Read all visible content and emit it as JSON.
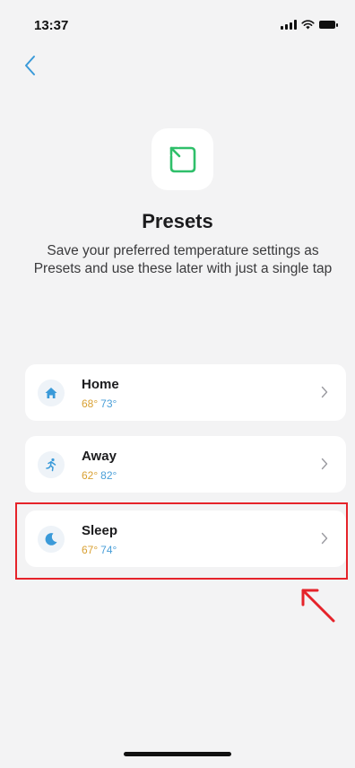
{
  "status_bar": {
    "time": "13:37"
  },
  "header": {
    "title": "Presets",
    "description": "Save your preferred temperature settings as Presets and use these later with just a single tap"
  },
  "presets": [
    {
      "name": "Home",
      "low": "68°",
      "high": "73°",
      "icon": "home-icon"
    },
    {
      "name": "Away",
      "low": "62°",
      "high": "82°",
      "icon": "running-person-icon"
    },
    {
      "name": "Sleep",
      "low": "67°",
      "high": "74°",
      "icon": "moon-icon"
    }
  ],
  "colors": {
    "accent": "#3a9ad9",
    "warm_temp": "#d9a133",
    "cool_temp": "#4a9fd8",
    "highlight": "#e5232a",
    "icon_green": "#2fbf6a"
  }
}
